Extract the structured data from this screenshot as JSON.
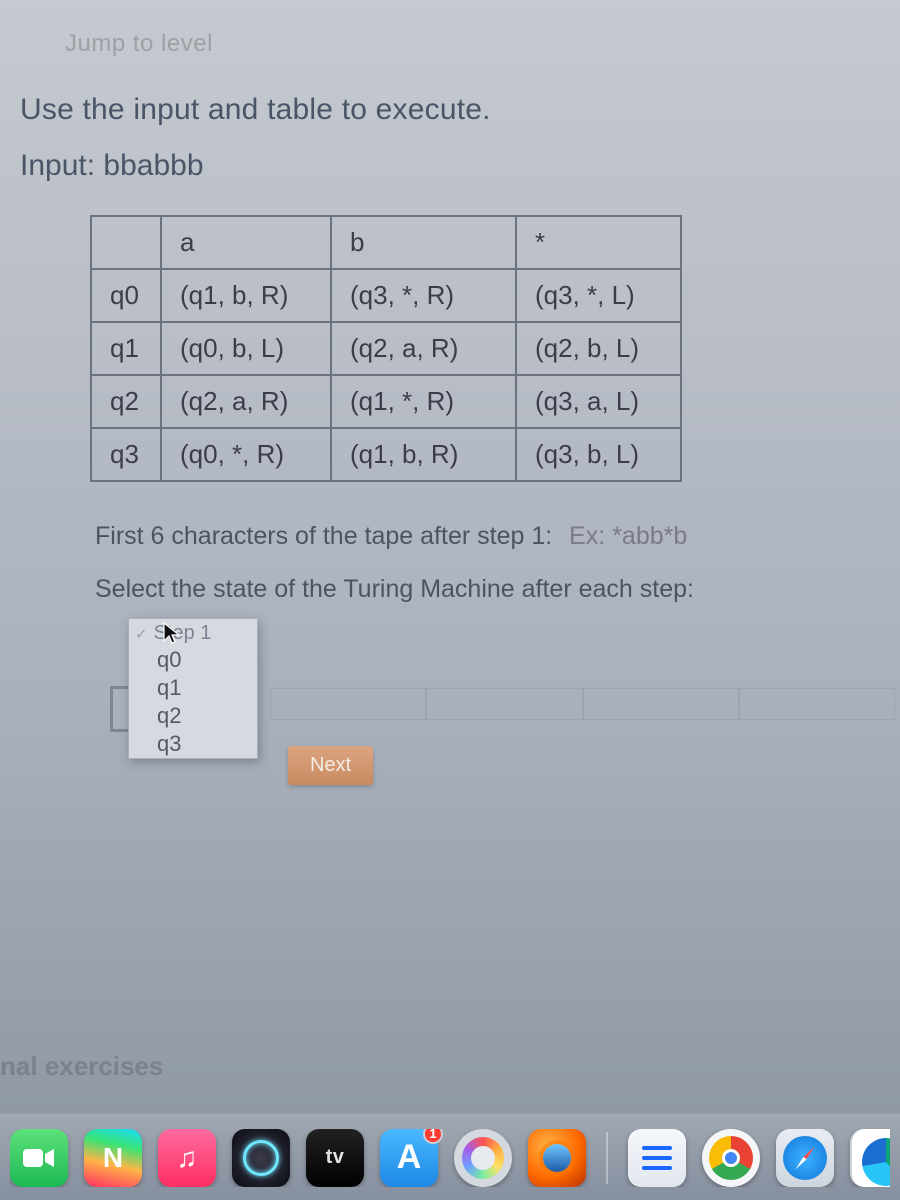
{
  "top_crop_text": "Jump to level",
  "instruction": "Use the input and table to execute.",
  "input_line": "Input: bbabbb",
  "table": {
    "headers": [
      "",
      "a",
      "b",
      "*"
    ],
    "rows": [
      {
        "state": "q0",
        "a": "(q1, b, R)",
        "b": "(q3, *, R)",
        "star": "(q3, *, L)"
      },
      {
        "state": "q1",
        "a": "(q0, b, L)",
        "b": "(q2, a, R)",
        "star": "(q2, b, L)"
      },
      {
        "state": "q2",
        "a": "(q2, a, R)",
        "b": "(q1, *, R)",
        "star": "(q3, a, L)"
      },
      {
        "state": "q3",
        "a": "(q0, *, R)",
        "b": "(q1, b, R)",
        "star": "(q3, b, L)"
      }
    ]
  },
  "prompt1_text": "First 6 characters of the tape after step 1:",
  "prompt1_example": "Ex: *abb*b",
  "prompt2_text": "Select the state of the Turing Machine after each step:",
  "dropdown": {
    "header": "Step 1",
    "items": [
      "q0",
      "q1",
      "q2",
      "q3"
    ]
  },
  "step_cells": [
    "2",
    "3",
    "4"
  ],
  "next_button": "Next",
  "footer_text": "nal exercises",
  "dock": {
    "tv": "tv",
    "app": "A",
    "badge_app": "1",
    "n": "N",
    "music": "♫"
  }
}
